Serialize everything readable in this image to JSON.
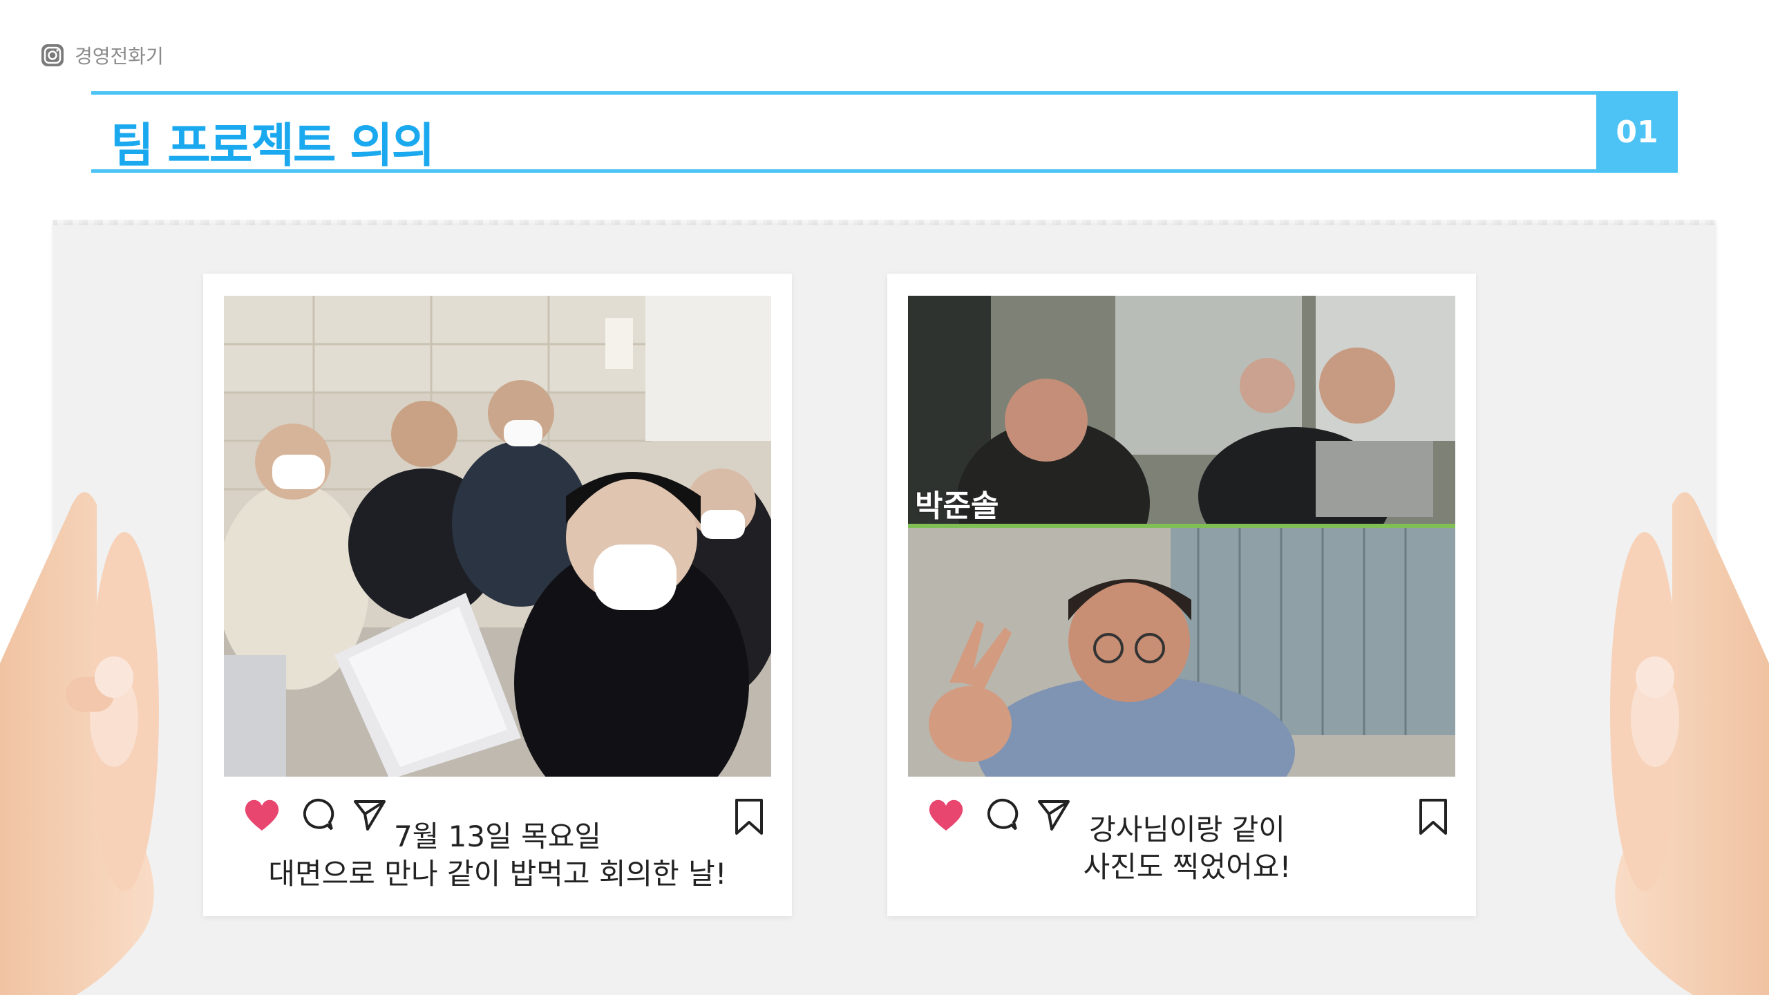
{
  "brand": {
    "name": "경영전화기",
    "icon": "instagram-icon"
  },
  "header": {
    "title": "팀 프로젝트 의의",
    "number": "01"
  },
  "posts": [
    {
      "photo_description_icon": "group-selfie-photo",
      "caption_line1": "7월 13일 목요일",
      "caption_line2": "대면으로 만나 같이 밥먹고 회의한 날!"
    },
    {
      "photo_description_icon": "video-call-photo",
      "video_label": "박준솔",
      "caption_line1": "강사님이랑 같이",
      "caption_line2": "사진도 찍었어요!"
    }
  ],
  "colors": {
    "accent": "#4cc3f4",
    "title": "#1aa8ef",
    "heart": "#e8466f"
  }
}
